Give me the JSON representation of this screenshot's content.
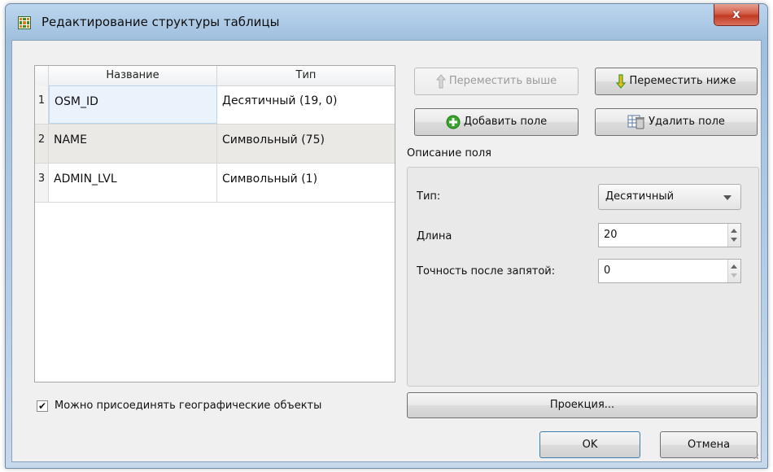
{
  "window": {
    "title": "Редактирование структуры таблицы",
    "close_label": "x"
  },
  "table": {
    "columns": [
      "Название",
      "Тип"
    ],
    "rows": [
      {
        "num": "1",
        "name": "OSM_ID",
        "type": "Десятичный (19, 0)"
      },
      {
        "num": "2",
        "name": "NAME",
        "type": "Символьный (75)"
      },
      {
        "num": "3",
        "name": "ADMIN_LVL",
        "type": "Символьный (1)"
      }
    ]
  },
  "buttons": {
    "move_up": "Переместить выше",
    "move_down": "Переместить ниже",
    "add_field": "Добавить поле",
    "delete_field": "Удалить поле",
    "projection": "Проекция...",
    "ok": "OK",
    "cancel": "Отмена"
  },
  "field_description": {
    "group_label": "Описание поля",
    "type_label": "Тип:",
    "type_value": "Десятичный",
    "length_label": "Длина",
    "length_value": "20",
    "precision_label": "Точность после запятой:",
    "precision_value": "0"
  },
  "checkbox": {
    "label": "Можно присоединять географические объекты",
    "checked": true,
    "mark": "✔"
  },
  "colors": {
    "accent_green": "#39a52a",
    "close_red": "#c23a22",
    "selection": "#eaf3fc"
  }
}
